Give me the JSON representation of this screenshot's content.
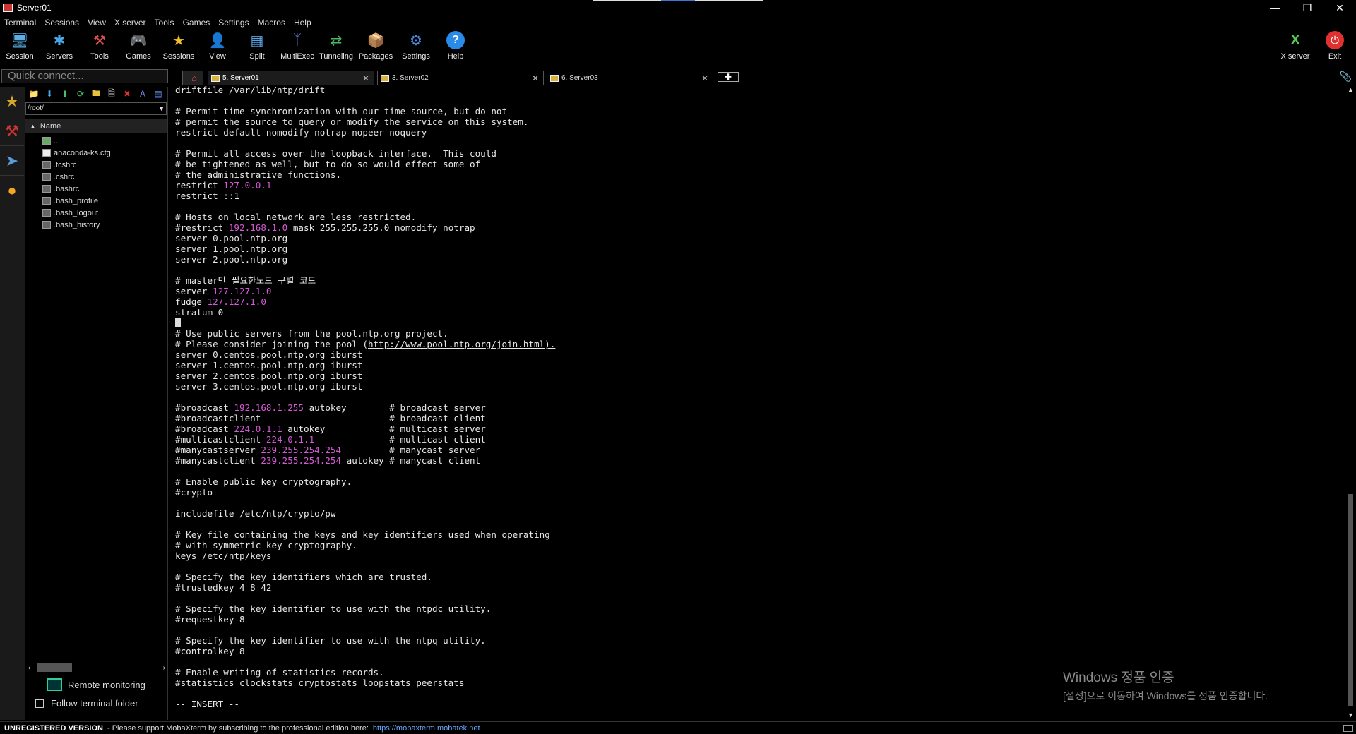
{
  "window": {
    "title": "Server01"
  },
  "menu": [
    "Terminal",
    "Sessions",
    "View",
    "X server",
    "Tools",
    "Games",
    "Settings",
    "Macros",
    "Help"
  ],
  "toolbar": {
    "session": "Session",
    "servers": "Servers",
    "tools": "Tools",
    "games": "Games",
    "sessions": "Sessions",
    "view": "View",
    "split": "Split",
    "multiexec": "MultiExec",
    "tunneling": "Tunneling",
    "packages": "Packages",
    "settings": "Settings",
    "help": "Help",
    "xserver": "X server",
    "exit": "Exit"
  },
  "quick_connect": {
    "placeholder": "Quick connect..."
  },
  "sftp": {
    "path": "/root/",
    "column": "Name",
    "files": [
      "..",
      "anaconda-ks.cfg",
      ".tcshrc",
      ".cshrc",
      ".bashrc",
      ".bash_profile",
      ".bash_logout",
      ".bash_history"
    ],
    "remote_monitoring": "Remote monitoring",
    "follow_terminal": "Follow terminal folder"
  },
  "tabs": [
    {
      "label": "5. Server01"
    },
    {
      "label": "3. Server02"
    },
    {
      "label": "6. Server03"
    }
  ],
  "terminal": {
    "lines": [
      "driftfile /var/lib/ntp/drift",
      "",
      "# Permit time synchronization with our time source, but do not",
      "# permit the source to query or modify the service on this system.",
      "restrict default nomodify notrap nopeer noquery",
      "",
      "# Permit all access over the loopback interface.  This could",
      "# be tightened as well, but to do so would effect some of",
      "# the administrative functions.",
      "restrict 127.0.0.1",
      "restrict ::1",
      "",
      "# Hosts on local network are less restricted.",
      "#restrict 192.168.1.0 mask 255.255.255.0 nomodify notrap",
      "server 0.pool.ntp.org",
      "server 1.pool.ntp.org",
      "server 2.pool.ntp.org",
      "",
      "# master만 필요한노드 구별 코드",
      "server 127.127.1.0",
      "fudge 127.127.1.0",
      "stratum 0",
      "",
      "# Use public servers from the pool.ntp.org project.",
      "# Please consider joining the pool (http://www.pool.ntp.org/join.html).",
      "server 0.centos.pool.ntp.org iburst",
      "server 1.centos.pool.ntp.org iburst",
      "server 2.centos.pool.ntp.org iburst",
      "server 3.centos.pool.ntp.org iburst",
      "",
      "#broadcast 192.168.1.255 autokey        # broadcast server",
      "#broadcastclient                        # broadcast client",
      "#broadcast 224.0.1.1 autokey            # multicast server",
      "#multicastclient 224.0.1.1              # multicast client",
      "#manycastserver 239.255.254.254         # manycast server",
      "#manycastclient 239.255.254.254 autokey # manycast client",
      "",
      "# Enable public key cryptography.",
      "#crypto",
      "",
      "includefile /etc/ntp/crypto/pw",
      "",
      "# Key file containing the keys and key identifiers used when operating",
      "# with symmetric key cryptography.",
      "keys /etc/ntp/keys",
      "",
      "# Specify the key identifiers which are trusted.",
      "#trustedkey 4 8 42",
      "",
      "# Specify the key identifier to use with the ntpdc utility.",
      "#requestkey 8",
      "",
      "# Specify the key identifier to use with the ntpq utility.",
      "#controlkey 8",
      "",
      "# Enable writing of statistics records.",
      "#statistics clockstats cryptostats loopstats peerstats",
      "",
      "-- INSERT --"
    ],
    "cursor_line": 22,
    "highlight_color": "#d65ad6"
  },
  "watermark": {
    "line1": "Windows 정품 인증",
    "line2": "[설정]으로 이동하여 Windows를 정품 인증합니다."
  },
  "status": {
    "unregistered": "UNREGISTERED VERSION",
    "message": "-  Please support MobaXterm by subscribing to the professional edition here:",
    "url": "https://mobaxterm.mobatek.net"
  }
}
